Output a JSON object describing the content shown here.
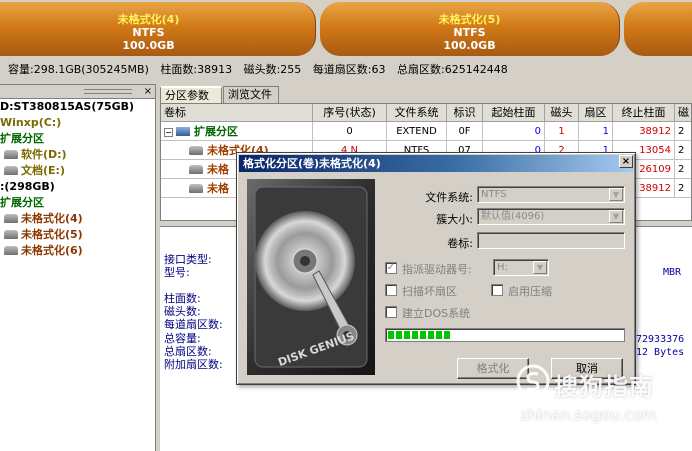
{
  "partitions": [
    {
      "name": "未格式化(4)",
      "fs": "NTFS",
      "size": "100.0GB"
    },
    {
      "name": "未格式化(5)",
      "fs": "NTFS",
      "size": "100.0GB"
    }
  ],
  "info_line": {
    "capacity": "容量:298.1GB(305245MB)",
    "cylinders": "柱面数:38913",
    "heads": "磁头数:255",
    "sectors_per_track": "每道扇区数:63",
    "total_sectors": "总扇区数:625142448"
  },
  "tree": {
    "close": "×",
    "items": [
      {
        "label": "D:ST380815AS(75GB)",
        "indent": 0,
        "color": "dark",
        "icon": false
      },
      {
        "label": "Winxp(C:)",
        "indent": 0,
        "color": "olive",
        "icon": false
      },
      {
        "label": "扩展分区",
        "indent": 0,
        "color": "green",
        "icon": false
      },
      {
        "label": "软件(D:)",
        "indent": 1,
        "color": "olive",
        "icon": true
      },
      {
        "label": "文档(E:)",
        "indent": 1,
        "color": "olive",
        "icon": true
      },
      {
        "label": ":(298GB)",
        "indent": 0,
        "color": "dark",
        "icon": false
      },
      {
        "label": "扩展分区",
        "indent": 0,
        "color": "green",
        "icon": false
      },
      {
        "label": "未格式化(4)",
        "indent": 1,
        "color": "brown",
        "icon": true
      },
      {
        "label": "未格式化(5)",
        "indent": 1,
        "color": "brown",
        "icon": true
      },
      {
        "label": "未格式化(6)",
        "indent": 1,
        "color": "brown",
        "icon": true
      }
    ]
  },
  "tabs": [
    "分区参数",
    "浏览文件"
  ],
  "grid": {
    "headers": [
      "卷标",
      "序号(状态)",
      "文件系统",
      "标识",
      "起始柱面",
      "磁头",
      "扇区",
      "终止柱面",
      "磁"
    ],
    "rows": [
      {
        "label": "扩展分区",
        "no": "0",
        "fs": "EXTEND",
        "id": "0F",
        "start_cyl": "0",
        "head": "1",
        "sector": "1",
        "end_cyl": "38912",
        "extra": "2"
      },
      {
        "label": "未格式化(4)",
        "no": "4 N",
        "fs": "NTFS",
        "id": "07",
        "start_cyl": "0",
        "head": "2",
        "sector": "1",
        "end_cyl": "13054",
        "extra": "2"
      },
      {
        "label": "未格",
        "no": "",
        "fs": "",
        "id": "",
        "start_cyl": "",
        "head": "",
        "sector": "",
        "end_cyl": "26109",
        "extra": "2"
      },
      {
        "label": "未格",
        "no": "",
        "fs": "",
        "id": "",
        "start_cyl": "",
        "head": "",
        "sector": "",
        "end_cyl": "38912",
        "extra": "2"
      }
    ]
  },
  "lower_info": {
    "interface_type": "接口类型:",
    "model": "型号:",
    "cylinders": "柱面数:",
    "heads": "磁头数:",
    "sectors_per_track": "每道扇区数:",
    "total_capacity": "总容量:",
    "total_sectors": "总扇区数:",
    "extra_sectors": "附加扇区数:",
    "mbr": "MBR",
    "right_val_1": "72933376",
    "right_val_2": "12 Bytes"
  },
  "dialog": {
    "title": "格式化分区(卷)未格式化(4)",
    "close": "×",
    "disk_logo": "DISK GENIUS",
    "fs_label": "文件系统:",
    "fs_value": "NTFS",
    "cluster_label": "簇大小:",
    "cluster_value": "默认值(4096)",
    "volume_label": "卷标:",
    "volume_value": "",
    "assign_label": "指派驱动器号:",
    "assign_value": "H:",
    "scan_label": "扫描坏扇区",
    "compress_label": "启用压缩",
    "dos_label": "建立DOS系统",
    "progress": 0.27,
    "format_button": "格式化",
    "cancel_button": "取消"
  },
  "watermark": {
    "text": "搜狗指南",
    "url": "zhinan.sogou.com"
  }
}
